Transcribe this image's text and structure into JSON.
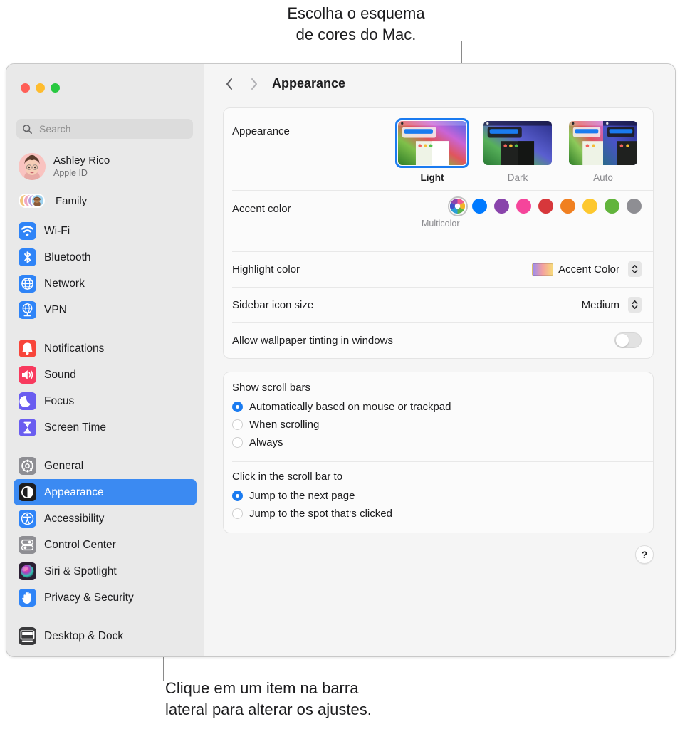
{
  "callouts": {
    "top": "Escolha o esquema\nde cores do Mac.",
    "bottom": "Clique em um item na barra\nlateral para alterar os ajustes."
  },
  "window": {
    "traffic_lights": [
      "close",
      "minimize",
      "zoom"
    ]
  },
  "sidebar": {
    "search": {
      "placeholder": "Search",
      "value": "",
      "icon": "search-icon"
    },
    "account": {
      "name": "Ashley Rico",
      "subtitle": "Apple ID"
    },
    "family": {
      "label": "Family"
    },
    "groups": [
      {
        "items": [
          {
            "label": "Wi-Fi",
            "icon": "wifi-icon",
            "color": "#2f84f7"
          },
          {
            "label": "Bluetooth",
            "icon": "bluetooth-icon",
            "color": "#2f84f7"
          },
          {
            "label": "Network",
            "icon": "globe-icon",
            "color": "#2f84f7"
          },
          {
            "label": "VPN",
            "icon": "vpn-icon",
            "color": "#2f84f7"
          }
        ]
      },
      {
        "items": [
          {
            "label": "Notifications",
            "icon": "bell-icon",
            "color": "#f8453a"
          },
          {
            "label": "Sound",
            "icon": "speaker-icon",
            "color": "#f83a5e"
          },
          {
            "label": "Focus",
            "icon": "moon-icon",
            "color": "#6a5df0"
          },
          {
            "label": "Screen Time",
            "icon": "hourglass-icon",
            "color": "#6a5df0"
          }
        ]
      },
      {
        "items": [
          {
            "label": "General",
            "icon": "gear-icon",
            "color": "#8e8e93"
          },
          {
            "label": "Appearance",
            "icon": "appearance-icon",
            "color": "#1c1c1e",
            "selected": true
          },
          {
            "label": "Accessibility",
            "icon": "accessibility-icon",
            "color": "#2f84f7"
          },
          {
            "label": "Control Center",
            "icon": "control-center-icon",
            "color": "#8e8e93"
          },
          {
            "label": "Siri & Spotlight",
            "icon": "siri-icon",
            "color": "#2b1e33"
          },
          {
            "label": "Privacy & Security",
            "icon": "hand-icon",
            "color": "#2f84f7"
          }
        ]
      },
      {
        "items": [
          {
            "label": "Desktop & Dock",
            "icon": "desktop-dock-icon",
            "color": "#3a3a3c"
          }
        ]
      }
    ],
    "selected_accent": "#3b8af2"
  },
  "toolbar": {
    "back_icon": "chevron-left-icon",
    "forward_icon": "chevron-right-icon",
    "title": "Appearance"
  },
  "main": {
    "appearance": {
      "label": "Appearance",
      "options": [
        {
          "name": "Light",
          "selected": true
        },
        {
          "name": "Dark",
          "selected": false
        },
        {
          "name": "Auto",
          "selected": false
        }
      ]
    },
    "accent_color": {
      "label": "Accent color",
      "caption": "Multicolor",
      "swatches": [
        {
          "name": "multicolor",
          "color": "multicolor",
          "selected": true
        },
        {
          "name": "blue",
          "color": "#007aff",
          "selected": false
        },
        {
          "name": "purple",
          "color": "#8944ab",
          "selected": false
        },
        {
          "name": "pink",
          "color": "#f5459b",
          "selected": false
        },
        {
          "name": "red",
          "color": "#d7373b",
          "selected": false
        },
        {
          "name": "orange",
          "color": "#f08021",
          "selected": false
        },
        {
          "name": "yellow",
          "color": "#fdc82f",
          "selected": false
        },
        {
          "name": "green",
          "color": "#62b43c",
          "selected": false
        },
        {
          "name": "graphite",
          "color": "#8e8e93",
          "selected": false
        }
      ]
    },
    "highlight_color": {
      "label": "Highlight color",
      "value": "Accent Color",
      "swatch_gradient": [
        "#9a8cf0",
        "#f4a0a0",
        "#f7d97a"
      ]
    },
    "sidebar_icon_size": {
      "label": "Sidebar icon size",
      "value": "Medium"
    },
    "wallpaper_tinting": {
      "label": "Allow wallpaper tinting in windows",
      "enabled": false
    },
    "show_scroll_bars": {
      "label": "Show scroll bars",
      "options": [
        {
          "label": "Automatically based on mouse or trackpad",
          "selected": true
        },
        {
          "label": "When scrolling",
          "selected": false
        },
        {
          "label": "Always",
          "selected": false
        }
      ]
    },
    "click_scroll_bar": {
      "label": "Click in the scroll bar to",
      "options": [
        {
          "label": "Jump to the next page",
          "selected": true
        },
        {
          "label": "Jump to the spot that‘s clicked",
          "selected": false
        }
      ]
    },
    "help_button": {
      "label": "?"
    }
  }
}
